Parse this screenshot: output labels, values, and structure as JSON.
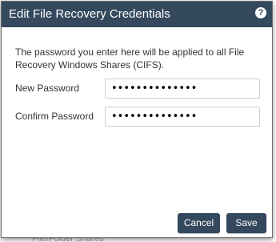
{
  "background": {
    "fragment_text": "File/Folder Shares"
  },
  "dialog": {
    "title": "Edit File Recovery Credentials",
    "help_icon": "question-circle-icon",
    "header_color": "#34495e",
    "description": "The password you enter here will be applied to all File Recovery Windows Shares (CIFS).",
    "fields": {
      "new_password": {
        "label": "New Password",
        "value": "••••••••••••••"
      },
      "confirm_password": {
        "label": "Confirm Password",
        "value": "••••••••••••••"
      }
    },
    "buttons": {
      "cancel_label": "Cancel",
      "save_label": "Save"
    }
  }
}
